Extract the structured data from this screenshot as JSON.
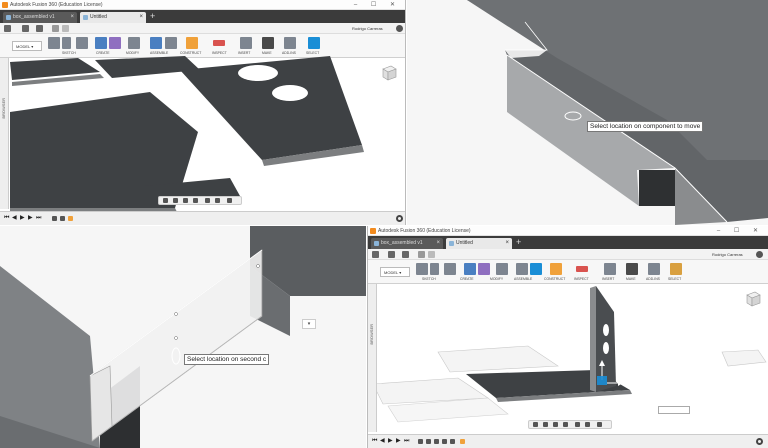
{
  "app": {
    "window_title": "Autodesk Fusion 360 (Education License)",
    "tabs": [
      "box_assembled v1",
      "Untitled"
    ],
    "user": "Rodrigo Carreras",
    "workspace": "MODEL"
  },
  "ribbon": {
    "groups": [
      "SKETCH",
      "CREATE",
      "MODIFY",
      "ASSEMBLE",
      "CONSTRUCT",
      "INSPECT",
      "INSERT",
      "MAKE",
      "ADD-INS",
      "SELECT"
    ]
  },
  "browser_label": "BROWSER",
  "prompts": {
    "move_tooltip": "Select location on component to move",
    "second_tooltip": "Select location on second c"
  },
  "timeline": {
    "buttons": [
      "skip-start",
      "step-back",
      "play",
      "step-forward",
      "skip-end"
    ]
  },
  "colors": {
    "part_top": "#3e4144",
    "part_side": "#7c7e80",
    "selected_blue": "#1a8ed6",
    "ribbon_bg": "#f7f7f7",
    "tabbar_bg": "#3b3b3b"
  }
}
